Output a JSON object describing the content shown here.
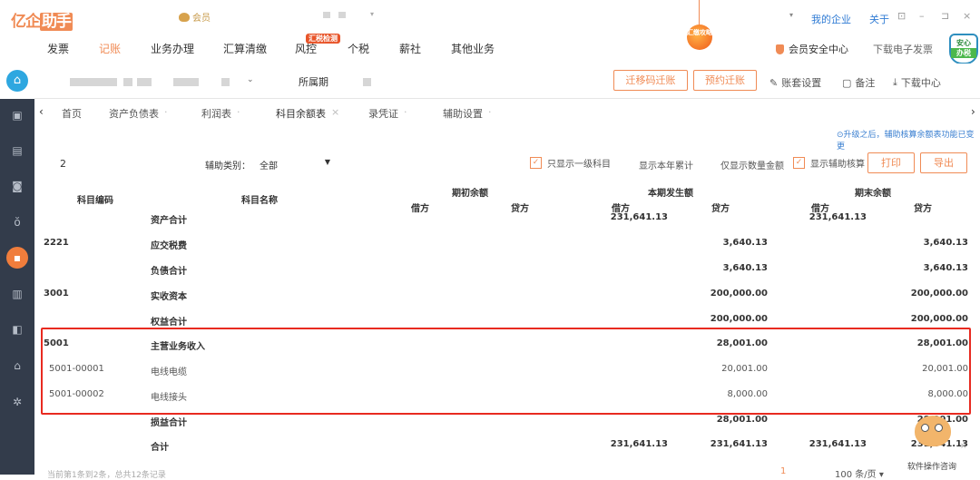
{
  "app": {
    "logo_text": "亿企",
    "logo_boxed": "助手",
    "vip_label": "会员",
    "top_links": {
      "my_company": "我的企业",
      "about": "关于"
    },
    "window_controls": [
      "⊡",
      "–",
      "⊐",
      "×"
    ]
  },
  "main_nav": {
    "items": [
      {
        "label": "发票",
        "active": false
      },
      {
        "label": "记账",
        "active": true
      },
      {
        "label": "业务办理",
        "active": false
      },
      {
        "label": "汇算清缴",
        "active": false
      },
      {
        "label": "风控",
        "active": false
      },
      {
        "label": "个税",
        "active": false
      },
      {
        "label": "薪社",
        "active": false
      },
      {
        "label": "其他业务",
        "active": false
      }
    ],
    "hot_badge": "汇税检测",
    "promo_ball": "汇缴攻略",
    "security_center": "会员安全中心",
    "download_invoice": "下载电子发票",
    "anxin_top": "安心",
    "anxin_bottom": "办税"
  },
  "toolbar": {
    "period_label": "所属期",
    "btn_transfer_code": "迁移码迁账",
    "btn_reserve_transfer": "预约迁账",
    "account_settings": "账套设置",
    "notes": "备注",
    "download_center": "下载中心"
  },
  "sidebar": {
    "items": [
      {
        "icon": "wallet-star-icon",
        "glyph": "▣",
        "active": false
      },
      {
        "icon": "document-icon",
        "glyph": "▤",
        "active": false
      },
      {
        "icon": "camera-icon",
        "glyph": "◙",
        "active": false
      },
      {
        "icon": "money-bag-icon",
        "glyph": "ŏ",
        "active": false
      },
      {
        "icon": "ledger-icon",
        "glyph": "▪",
        "active": true
      },
      {
        "icon": "bar-chart-icon",
        "glyph": "▥",
        "active": false
      },
      {
        "icon": "wallet-icon",
        "glyph": "◧",
        "active": false
      },
      {
        "icon": "tax-house-icon",
        "glyph": "⌂",
        "active": false
      },
      {
        "icon": "gear-icon",
        "glyph": "✲",
        "active": false
      }
    ]
  },
  "tabs": [
    {
      "label": "首页",
      "close": ""
    },
    {
      "label": "资产负债表",
      "close": "·"
    },
    {
      "label": "利润表",
      "close": "·"
    },
    {
      "label": "科目余额表",
      "close": "×",
      "active": true
    },
    {
      "label": "录凭证",
      "close": "·"
    },
    {
      "label": "辅助设置",
      "close": "·"
    }
  ],
  "notice": "⊙升级之后，辅助核算余额表功能已变更",
  "filters": {
    "page_number": "2",
    "aux_category_label": "辅助类别：",
    "aux_category_value": "全部",
    "only_level1": {
      "label": "只显示一级科目",
      "checked": true
    },
    "show_year_total": "显示本年累计",
    "only_qty_amount": "仅显示数量金额",
    "show_aux": {
      "label": "显示辅助核算",
      "checked": true
    },
    "print_button": "打印",
    "export_button": "导出"
  },
  "table": {
    "headers": {
      "code": "科目编码",
      "name": "科目名称",
      "opening": "期初余额",
      "current": "本期发生额",
      "closing": "期末余额",
      "debit": "借方",
      "credit": "贷方"
    },
    "rows": [
      {
        "code": "",
        "name": "资产合计",
        "open_d": "",
        "open_c": "",
        "cur_d": "231,641.13",
        "cur_c": "",
        "close_d": "231,641.13",
        "close_c": "",
        "bold": true,
        "partial": true
      },
      {
        "code": "2221",
        "name": "应交税费",
        "open_d": "",
        "open_c": "",
        "cur_d": "",
        "cur_c": "3,640.13",
        "close_d": "",
        "close_c": "3,640.13",
        "bold": true
      },
      {
        "code": "",
        "name": "负债合计",
        "open_d": "",
        "open_c": "",
        "cur_d": "",
        "cur_c": "3,640.13",
        "close_d": "",
        "close_c": "3,640.13",
        "bold": true
      },
      {
        "code": "3001",
        "name": "实收资本",
        "open_d": "",
        "open_c": "",
        "cur_d": "",
        "cur_c": "200,000.00",
        "close_d": "",
        "close_c": "200,000.00",
        "bold": true
      },
      {
        "code": "",
        "name": "权益合计",
        "open_d": "",
        "open_c": "",
        "cur_d": "",
        "cur_c": "200,000.00",
        "close_d": "",
        "close_c": "200,000.00",
        "bold": true
      },
      {
        "code": "5001",
        "name": "主营业务收入",
        "open_d": "",
        "open_c": "",
        "cur_d": "",
        "cur_c": "28,001.00",
        "close_d": "",
        "close_c": "28,001.00",
        "bold": true
      },
      {
        "code": "5001-00001",
        "name": "电线电缆",
        "open_d": "",
        "open_c": "",
        "cur_d": "",
        "cur_c": "20,001.00",
        "close_d": "",
        "close_c": "20,001.00",
        "bold": false
      },
      {
        "code": "5001-00002",
        "name": "电线接头",
        "open_d": "",
        "open_c": "",
        "cur_d": "",
        "cur_c": "8,000.00",
        "close_d": "",
        "close_c": "8,000.00",
        "bold": false
      },
      {
        "code": "",
        "name": "损益合计",
        "open_d": "",
        "open_c": "",
        "cur_d": "",
        "cur_c": "28,001.00",
        "close_d": "",
        "close_c": "28,001.00",
        "bold": true
      },
      {
        "code": "",
        "name": "合计",
        "open_d": "",
        "open_c": "",
        "cur_d": "231,641.13",
        "cur_c": "231,641.13",
        "close_d": "231,641.13",
        "close_c": "231,641.13",
        "bold": true
      }
    ]
  },
  "footer": {
    "summary": "当前第1条到2条，总共12条记录",
    "current_page": "1",
    "page_size": "100 条/页 ▾"
  },
  "assistant": {
    "label": "软件操作咨询",
    "close": "×"
  },
  "colors": {
    "accent": "#f08b55",
    "highlight_border": "#e82a20",
    "sidebar_bg": "#333c4b",
    "link": "#2f7bd4"
  }
}
